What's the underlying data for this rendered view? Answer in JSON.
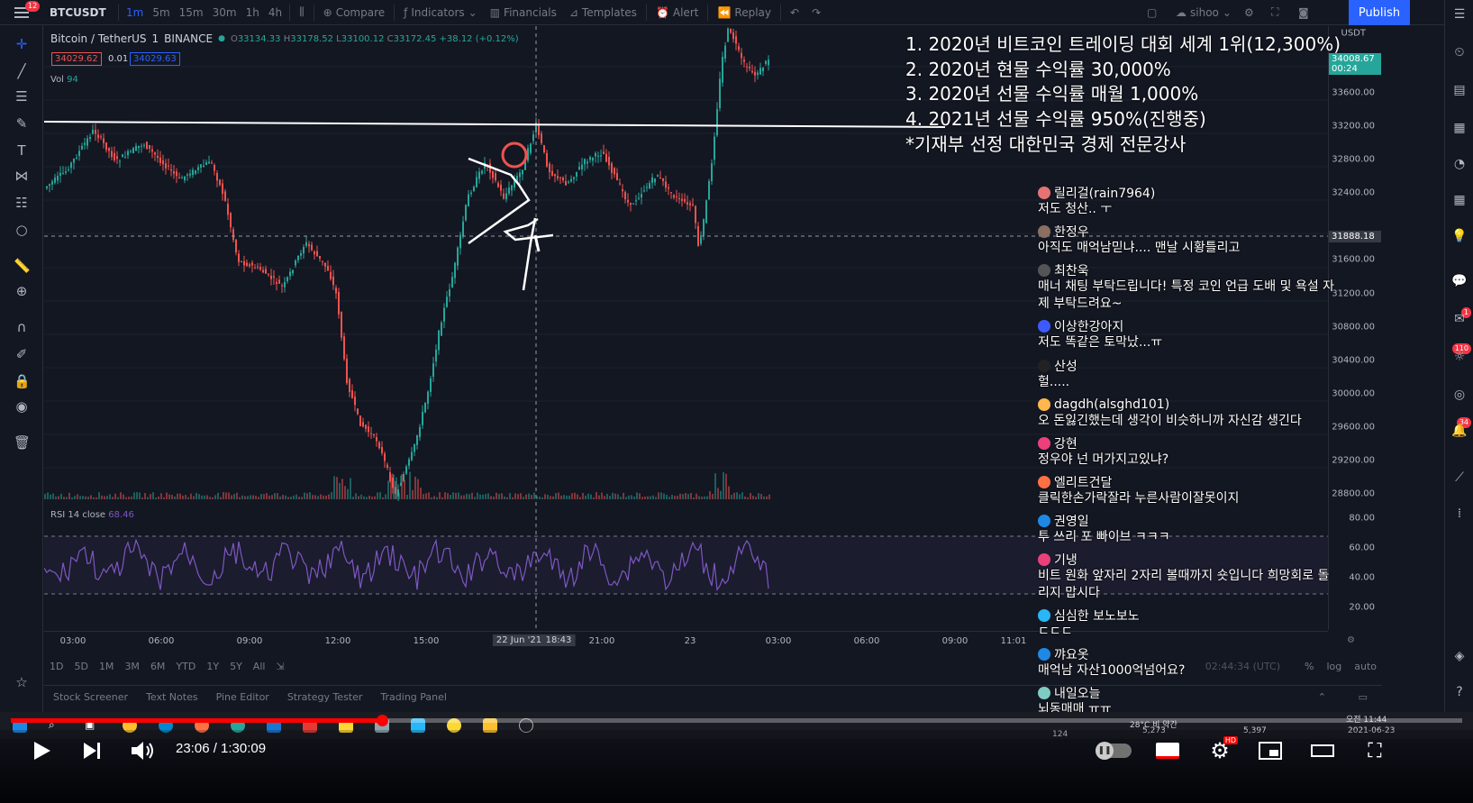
{
  "toolbar": {
    "menu_badge": "12",
    "symbol": "BTCUSDT",
    "intervals": [
      "1m",
      "5m",
      "15m",
      "30m",
      "1h",
      "4h"
    ],
    "active_interval": "1m",
    "compare": "Compare",
    "indicators": "Indicators",
    "financials": "Financials",
    "templates": "Templates",
    "alert": "Alert",
    "replay": "Replay",
    "user": "sihoo",
    "publish": "Publish"
  },
  "legend": {
    "title": "Bitcoin / TetherUS",
    "interval": "1",
    "exchange": "BINANCE",
    "open": "33134.33",
    "high": "33178.52",
    "low": "33100.12",
    "close": "33172.45",
    "change": "+38.12 (+0.12%)",
    "bid": "34029.62",
    "spread": "0.01",
    "ask": "34029.63",
    "vol_label": "Vol",
    "vol_value": "94",
    "rsi_label": "RSI 14 close",
    "rsi_value": "68.46"
  },
  "price_axis": {
    "ticks": [
      "33600.00",
      "33200.00",
      "32800.00",
      "32400.00",
      "32000.00",
      "31600.00",
      "31200.00",
      "30800.00",
      "30400.00",
      "30000.00",
      "29600.00",
      "29200.00",
      "28800.00"
    ],
    "last_price": "34008.67",
    "countdown": "00:24",
    "crosshair_price": "31888.18",
    "rsi_ticks": [
      "80.00",
      "60.00",
      "40.00",
      "20.00"
    ],
    "currency": "USDT"
  },
  "time_axis": {
    "ticks": [
      "03:00",
      "06:00",
      "09:00",
      "12:00",
      "15:00",
      "21:00",
      "23",
      "03:00",
      "06:00",
      "09:00",
      "11:01"
    ],
    "crosshair_date": "22 Jun '21",
    "crosshair_time": "18:43"
  },
  "range_bar": {
    "ranges": [
      "1D",
      "5D",
      "1M",
      "3M",
      "6M",
      "YTD",
      "1Y",
      "5Y",
      "All"
    ],
    "utc": "02:44:34 (UTC)",
    "pct": "%",
    "log": "log",
    "auto": "auto"
  },
  "bottom_tabs": [
    "Stock Screener",
    "Text Notes",
    "Pine Editor",
    "Strategy Tester",
    "Trading Panel"
  ],
  "overlay_text": [
    "1. 2020년 비트코인 트레이딩 대회 세계 1위(12,300%)",
    "2. 2020년 현물 수익률 30,000%",
    "3. 2020년 선물 수익률 매월 1,000%",
    "4. 2021년 선물 수익률 950%(진행중)",
    "*기재부 선정 대한민국 경제 전문강사"
  ],
  "chat": [
    {
      "name": "릴리걸(rain7964)",
      "lines": [
        "저도 청산.. ㅜ"
      ],
      "color": "#e57373"
    },
    {
      "name": "한정우",
      "lines": [
        "아직도 매억남믿냐.... 맨날 시황틀리고"
      ],
      "color": "#8d6e63"
    },
    {
      "name": "최찬욱",
      "lines": [
        "매너 채팅 부탁드립니다! 특정 코인 언급 도배 및 욕설 자",
        "제 부탁드려요~"
      ],
      "color": "#555555"
    },
    {
      "name": "이상한강아지",
      "lines": [
        "저도 똑같은 토막났...ㅠ"
      ],
      "color": "#3d5afe"
    },
    {
      "name": "산성",
      "lines": [
        "헐....."
      ],
      "color": "#222222"
    },
    {
      "name": "dagdh(alsghd101)",
      "lines": [
        "오 돈잃긴했는데 생각이 비슷하니까 자신감 생긴다"
      ],
      "color": "#ffb74d"
    },
    {
      "name": "강현",
      "lines": [
        "정우야 넌 머가지고있냐?"
      ],
      "color": "#ec407a"
    },
    {
      "name": "엘리트건달",
      "lines": [
        "클릭한손가락잘라 누른사람이잘못이지"
      ],
      "color": "#ff7043"
    },
    {
      "name": "권영일",
      "lines": [
        "투 쓰리 포 빠이브 ㅋㅋㅋ"
      ],
      "color": "#1e88e5"
    },
    {
      "name": "기냉",
      "lines": [
        "비트 원화 앞자리 2자리 볼때까지 숏입니다 희망회로 돌",
        "리지 맙시다"
      ],
      "color": "#ec407a"
    },
    {
      "name": "심심한 보노보노",
      "lines": [
        "ㄷㄷㄷ"
      ],
      "color": "#29b6f6"
    },
    {
      "name": "꺄요옷",
      "lines": [
        "매억남 자산1000억넘어요?"
      ],
      "color": "#1e88e5"
    },
    {
      "name": "내일오늘",
      "lines": [
        "뇌동매매 ㅠㅠ"
      ],
      "color": "#80cbc4"
    }
  ],
  "taskbar": {
    "viewers": "124",
    "likes": "5,273",
    "count": "5,397",
    "weather": "28°C 비 약간",
    "time": "오전 11:44",
    "date": "2021-06-23"
  },
  "right_badges": {
    "b1": "1",
    "b2": "110",
    "b3": "34"
  },
  "player": {
    "current": "23:06",
    "duration": "1:30:09",
    "time_display": "23:06 / 1:30:09",
    "progress": 0.256
  },
  "colors": {
    "bg": "#131722",
    "up": "#26a69a",
    "down": "#ef5350",
    "rsi": "#7e57c2",
    "accent": "#2962ff",
    "yt_red": "#ff0000"
  }
}
